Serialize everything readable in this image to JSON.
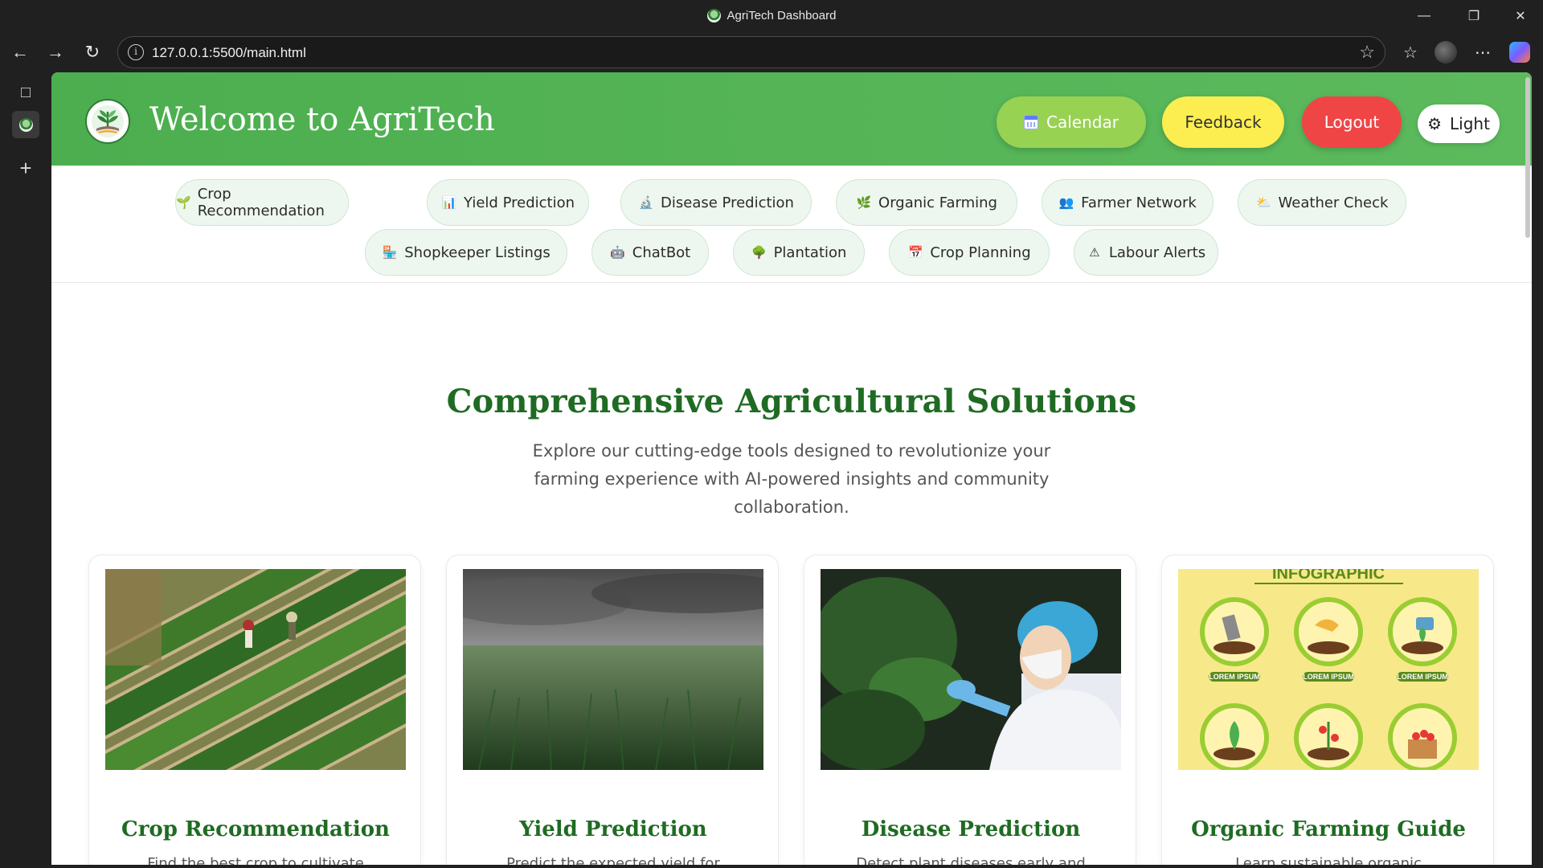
{
  "browser": {
    "tab_title": "AgriTech Dashboard",
    "url": "127.0.0.1:5500/main.html"
  },
  "header": {
    "brand": "Welcome to AgriTech",
    "buttons": {
      "calendar": "Calendar",
      "feedback": "Feedback",
      "logout": "Logout",
      "theme": "Light"
    }
  },
  "feature_nav": [
    {
      "label": "Crop Recommendation",
      "icon": "seedling-icon"
    },
    {
      "label": "Yield Prediction",
      "icon": "bar-chart-icon"
    },
    {
      "label": "Disease Prediction",
      "icon": "microscope-icon"
    },
    {
      "label": "Organic Farming",
      "icon": "herb-icon"
    },
    {
      "label": "Farmer Network",
      "icon": "people-icon"
    },
    {
      "label": "Weather Check",
      "icon": "weather-icon"
    },
    {
      "label": "Shopkeeper Listings",
      "icon": "shop-icon"
    },
    {
      "label": "ChatBot",
      "icon": "robot-icon"
    },
    {
      "label": "Plantation",
      "icon": "tree-icon"
    },
    {
      "label": "Crop Planning",
      "icon": "calendar-icon"
    },
    {
      "label": "Labour Alerts",
      "icon": "warning-icon"
    }
  ],
  "solutions": {
    "title": "Comprehensive Agricultural Solutions",
    "subtitle": "Explore our cutting-edge tools designed to revolutionize your farming experience with AI-powered insights and community collaboration."
  },
  "cards": [
    {
      "title": "Crop Recommendation",
      "desc": "Find the best crop to cultivate"
    },
    {
      "title": "Yield Prediction",
      "desc": "Predict the expected yield for"
    },
    {
      "title": "Disease Prediction",
      "desc": "Detect plant diseases early and"
    },
    {
      "title": "Organic Farming Guide",
      "desc": "Learn sustainable organic"
    }
  ],
  "infographic": {
    "heading": "INFOGRAPHIC",
    "badge": "LOREM IPSUM"
  },
  "colors": {
    "header_green": "#4cae4f",
    "title_green": "#1f6b23",
    "calendar_btn": "#98d253",
    "feedback_btn": "#fcee50",
    "logout_btn": "#ef4545"
  }
}
